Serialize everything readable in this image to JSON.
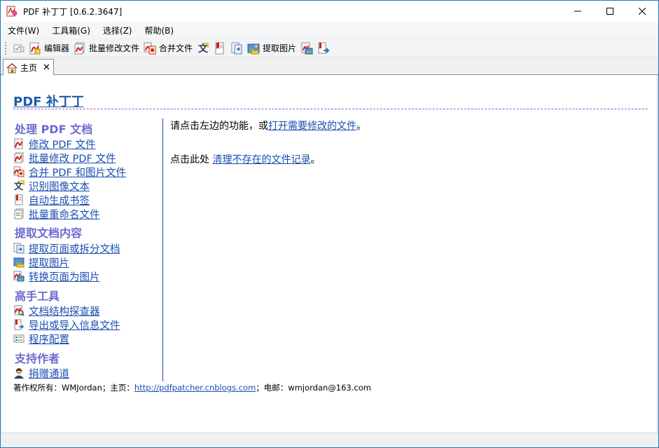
{
  "window": {
    "title": "PDF 补丁丁 [0.6.2.3647]",
    "minimize_glyph": "—",
    "maximize_glyph": "☐",
    "close_glyph": "✕"
  },
  "menu": [
    {
      "label": "文件(W)"
    },
    {
      "label": "工具箱(G)"
    },
    {
      "label": "选择(Z)"
    },
    {
      "label": "帮助(B)"
    }
  ],
  "toolbar": {
    "editor_label": "编辑器",
    "batch_modify_label": "批量修改文件",
    "merge_label": "合并文件",
    "extract_images_label": "提取图片",
    "icons": [
      "checkbox-icon",
      "pdf-editor-icon",
      "batch-modify-icon",
      "merge-icon",
      "ocr-icon",
      "bookmark-icon",
      "extract-pages-icon",
      "extract-images-icon",
      "render-icon",
      "export-icon"
    ]
  },
  "tabs": [
    {
      "label": "主页",
      "close": "✕",
      "icon": "home-icon"
    }
  ],
  "home": {
    "title": "PDF 补丁丁",
    "sections": [
      {
        "title": "处理 PDF 文档",
        "items": [
          {
            "label": "修改 PDF 文件",
            "icon": "pdf-edit-icon"
          },
          {
            "label": "批量修改 PDF 文件",
            "icon": "pdf-batch-icon"
          },
          {
            "label": "合并 PDF 和图片文件",
            "icon": "merge-files-icon"
          },
          {
            "label": "识别图像文本",
            "icon": "ocr-text-icon"
          },
          {
            "label": "自动生成书签",
            "icon": "auto-bookmark-icon"
          },
          {
            "label": "批量重命名文件",
            "icon": "rename-icon"
          }
        ]
      },
      {
        "title": "提取文档内容",
        "items": [
          {
            "label": "提取页面或拆分文档",
            "icon": "split-icon"
          },
          {
            "label": "提取图片",
            "icon": "image-extract-icon"
          },
          {
            "label": "转换页面为图片",
            "icon": "page-to-image-icon"
          }
        ]
      },
      {
        "title": "高手工具",
        "items": [
          {
            "label": "文档结构探查器",
            "icon": "inspector-icon"
          },
          {
            "label": "导出或导入信息文件",
            "icon": "info-file-icon"
          },
          {
            "label": "程序配置",
            "icon": "config-icon"
          }
        ]
      },
      {
        "title": "支持作者",
        "items": [
          {
            "label": "捐赠通道",
            "icon": "donate-user-icon"
          }
        ]
      }
    ],
    "main": {
      "line1_prefix": "请点击左边的功能，或",
      "line1_link": "打开需要修改的文件",
      "line1_suffix": "。",
      "line2_prefix": "点击此处 ",
      "line2_link": "清理不存在的文件记录",
      "line2_suffix": "。"
    },
    "footer": {
      "copyright_prefix": "著作权所有：WMJordan；主页：",
      "homepage": "http://pdfpatcher.cnblogs.com",
      "email_text": "；电邮：wmjordan@163.com"
    }
  },
  "colors": {
    "link": "#1a4eb0",
    "section_title": "#6b6bd0",
    "header_title": "#1e5aa8",
    "pdf_red": "#d0211c"
  }
}
